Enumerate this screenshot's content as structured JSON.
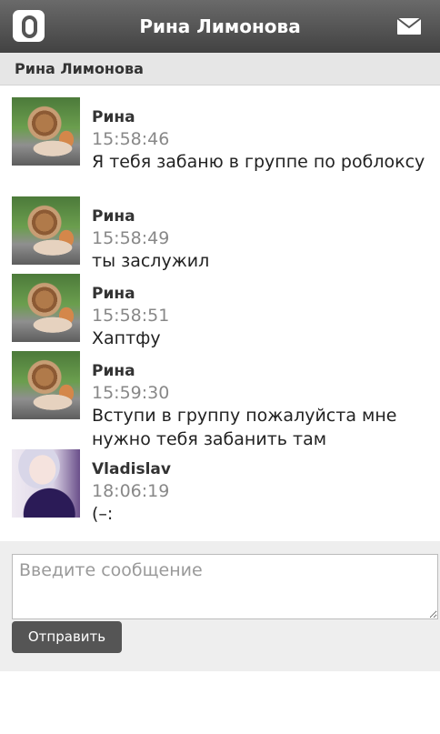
{
  "header": {
    "title": "Рина Лимонова",
    "logo_icon": "odnoklassniki-logo-icon",
    "mail_icon": "mail-icon"
  },
  "subheader": {
    "name": "Рина Лимонова"
  },
  "messages": [
    {
      "author": "Рина",
      "time": "15:58:46",
      "text": "Я тебя забаню в группе по роблоксу",
      "avatar": "snail-avatar"
    },
    {
      "author": "Рина",
      "time": "15:58:49",
      "text": "ты заслужил",
      "avatar": "snail-avatar"
    },
    {
      "author": "Рина",
      "time": "15:58:51",
      "text": "Хаптфу",
      "avatar": "snail-avatar"
    },
    {
      "author": "Рина",
      "time": "15:59:30",
      "text": "Вступи в группу пожалуйста мне нужно тебя забанить там",
      "avatar": "snail-avatar"
    },
    {
      "author": "Vladislav",
      "time": "18:06:19",
      "text": "(–:",
      "avatar": "anime-avatar"
    }
  ],
  "composer": {
    "placeholder": "Введите сообщение",
    "send_label": "Отправить"
  },
  "colors": {
    "topbar": "#4a4a4a",
    "subheader": "#e6e6e6",
    "time": "#888888",
    "button": "#555555"
  }
}
